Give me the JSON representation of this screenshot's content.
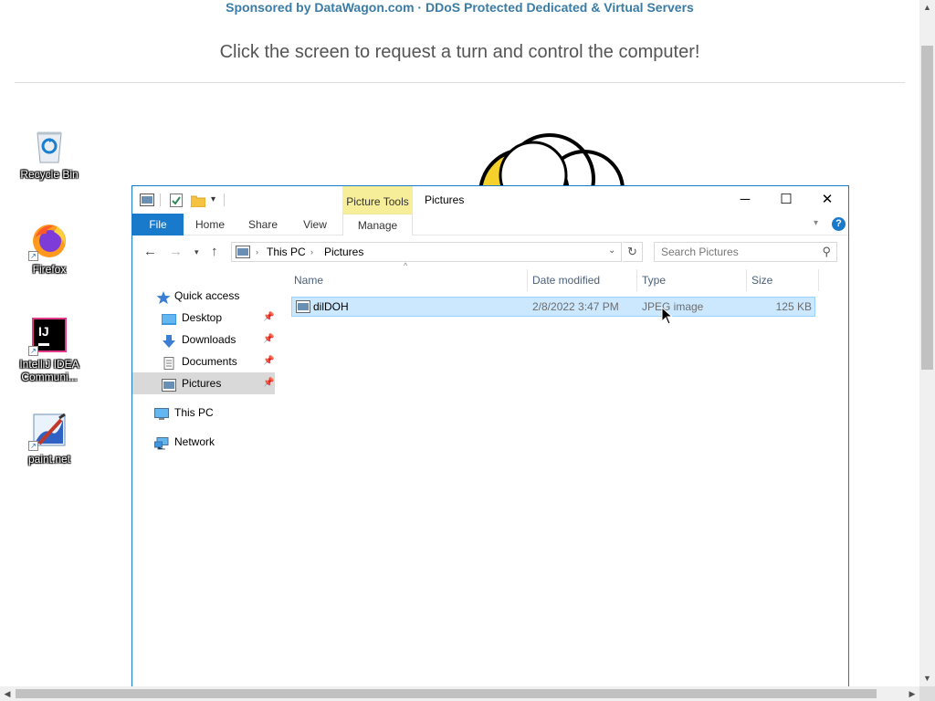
{
  "web": {
    "sponsor": "Sponsored by DataWagon.com · DDoS Protected Dedicated & Virtual Servers",
    "click_message": "Click the screen to request a turn and control the computer!"
  },
  "desktop": {
    "icons": [
      {
        "label": "Recycle Bin",
        "icon": "recycle-bin-icon"
      },
      {
        "label": "Firefox",
        "icon": "firefox-icon"
      },
      {
        "label": "IntelliJ IDEA Communi...",
        "icon": "intellij-icon"
      },
      {
        "label": "paint.net",
        "icon": "paintnet-icon"
      }
    ]
  },
  "explorer": {
    "title": "Pictures",
    "contextual_tab": "Picture Tools",
    "ribbon_tabs": [
      "File",
      "Home",
      "Share",
      "View",
      "Manage"
    ],
    "breadcrumb": [
      "This PC",
      "Pictures"
    ],
    "search_placeholder": "Search Pictures",
    "nav": {
      "quick_access": "Quick access",
      "items": [
        "Desktop",
        "Downloads",
        "Documents",
        "Pictures"
      ],
      "this_pc": "This PC",
      "network": "Network"
    },
    "columns": [
      "Name",
      "Date modified",
      "Type",
      "Size"
    ],
    "files": [
      {
        "name": "dilDOH",
        "date": "2/8/2022 3:47 PM",
        "type": "JPEG image",
        "size": "125 KB"
      }
    ]
  },
  "colors": {
    "accent": "#1979ca",
    "selection": "#cce8ff",
    "contextual": "#f7ee9a"
  }
}
